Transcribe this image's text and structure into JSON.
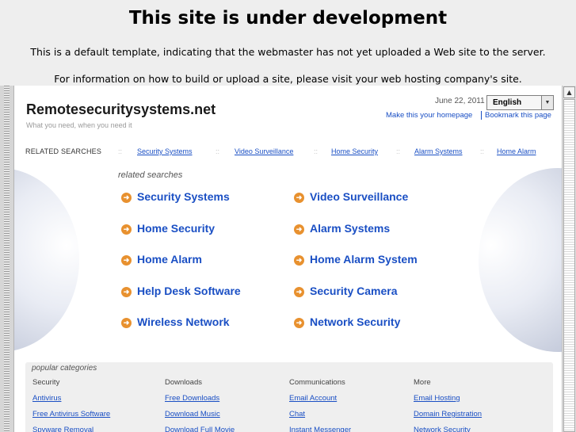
{
  "notice": {
    "heading": "This site is under development",
    "line1": "This is a default template, indicating that the webmaster has not yet uploaded a Web site to the server.",
    "line2": "For information on how to build or upload a site, please visit your web hosting company's site."
  },
  "site": {
    "title": "Remotesecuritysystems.net",
    "tagline": "What you need, when you need it",
    "date": "June 22, 2011",
    "language": "English",
    "make_homepage": "Make this your homepage",
    "bookmark": "Bookmark this page"
  },
  "related_bar": {
    "label": "RELATED SEARCHES",
    "separator": "::",
    "links": [
      "Security Systems",
      "Video Surveillance",
      "Home Security",
      "Alarm Systems",
      "Home Alarm"
    ]
  },
  "related": {
    "title": "related searches",
    "left": [
      "Security Systems",
      "Home Security",
      "Home Alarm",
      "Help Desk Software",
      "Wireless Network"
    ],
    "right": [
      "Video Surveillance",
      "Alarm Systems",
      "Home Alarm System",
      "Security Camera",
      "Network Security"
    ]
  },
  "popular": {
    "title": "popular categories",
    "columns": [
      {
        "heading": "Security",
        "links": [
          "Antivirus",
          "Free Antivirus Software",
          "Spyware Removal"
        ]
      },
      {
        "heading": "Downloads",
        "links": [
          "Free Downloads",
          "Download Music",
          "Download Full Movie"
        ]
      },
      {
        "heading": "Communications",
        "links": [
          "Email Account",
          "Chat",
          "Instant Messenger"
        ]
      },
      {
        "heading": "More",
        "links": [
          "Email Hosting",
          "Domain Registration",
          "Network Security"
        ]
      }
    ]
  },
  "icons": {
    "bullet": "arrow-circle-icon",
    "scroll_up": "arrow-up-icon",
    "dropdown": "chevron-down-icon"
  },
  "colors": {
    "link": "#1a4fc4",
    "bullet": "#e8912f",
    "page_bg": "#eeeeee"
  }
}
